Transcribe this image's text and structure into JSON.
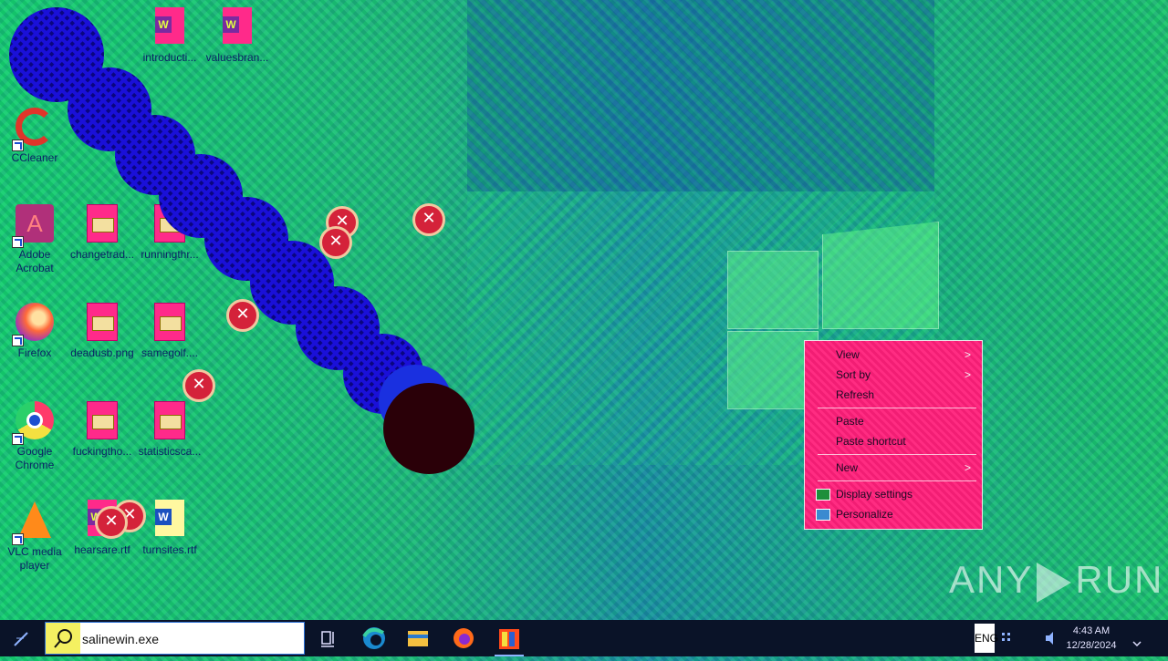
{
  "desktop": {
    "icons": [
      {
        "label": "introducti...",
        "type": "word"
      },
      {
        "label": "valuesbran...",
        "type": "word"
      },
      {
        "label": "CCleaner",
        "type": "app"
      },
      {
        "label": "Adobe Acrobat",
        "type": "app"
      },
      {
        "label": "changetrad...",
        "type": "image"
      },
      {
        "label": "runningthr...",
        "type": "image"
      },
      {
        "label": "Firefox",
        "type": "app"
      },
      {
        "label": "deadusb.png",
        "type": "image"
      },
      {
        "label": "samegolf....",
        "type": "image"
      },
      {
        "label": "Google Chrome",
        "type": "app"
      },
      {
        "label": "fuckingtho...",
        "type": "image"
      },
      {
        "label": "statisticsca...",
        "type": "image"
      },
      {
        "label": "VLC media player",
        "type": "app"
      },
      {
        "label": "hearsare.rtf",
        "type": "word"
      },
      {
        "label": "turnsites.rtf",
        "type": "word"
      }
    ]
  },
  "context_menu": {
    "items": [
      "View",
      "Sort by",
      "Refresh",
      "Paste",
      "Paste shortcut",
      "New",
      "Display settings",
      "Personalize"
    ],
    "submenu_glyph": ">"
  },
  "watermark": {
    "left": "ANY",
    "right": "RUN"
  },
  "taskbar": {
    "search_value": "salinewin.exe",
    "pinned": [
      "task-view",
      "edge",
      "file-explorer",
      "firefox",
      "winrar"
    ],
    "ime_label": "ENG",
    "clock_time": "4:43 AM",
    "clock_date": "12/28/2024"
  },
  "colors": {
    "menu_bg": "#ff1f7a",
    "trail": "#1a10d8",
    "ball": "#2a0008",
    "taskbar": "#0a1328"
  },
  "error_glyph": "✕"
}
